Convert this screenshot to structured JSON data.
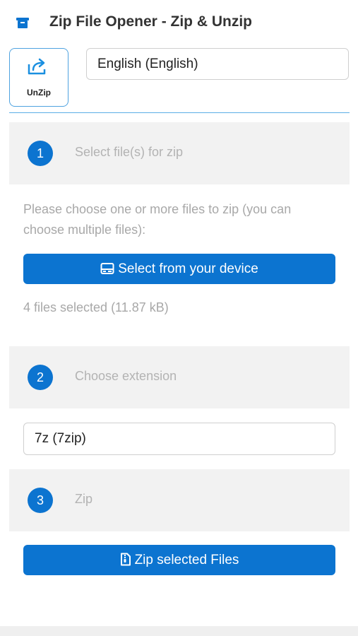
{
  "header": {
    "title": "Zip File Opener - Zip & Unzip"
  },
  "tabs": {
    "unzip_label": "UnZip"
  },
  "language": {
    "selected": "English (English)"
  },
  "steps": [
    {
      "number": "1",
      "label": "Select file(s) for zip"
    },
    {
      "number": "2",
      "label": "Choose extension"
    },
    {
      "number": "3",
      "label": "Zip"
    }
  ],
  "select_files": {
    "help_text": "Please choose one or more files to zip (you can choose multiple files):",
    "button_label": "Select from your device",
    "status": "4 files selected (11.87 kB)"
  },
  "extension": {
    "selected": "7z (7zip)"
  },
  "zip": {
    "button_label": "Zip selected Files"
  },
  "colors": {
    "accent": "#0c74d0",
    "step_background": "#f2f2f2",
    "muted_text": "#a8a8a8"
  },
  "icons": {
    "app": "archive-box-icon",
    "unzip_tab": "share-export-icon",
    "select_button": "hard-drive-icon",
    "zip_button": "zip-file-icon"
  }
}
